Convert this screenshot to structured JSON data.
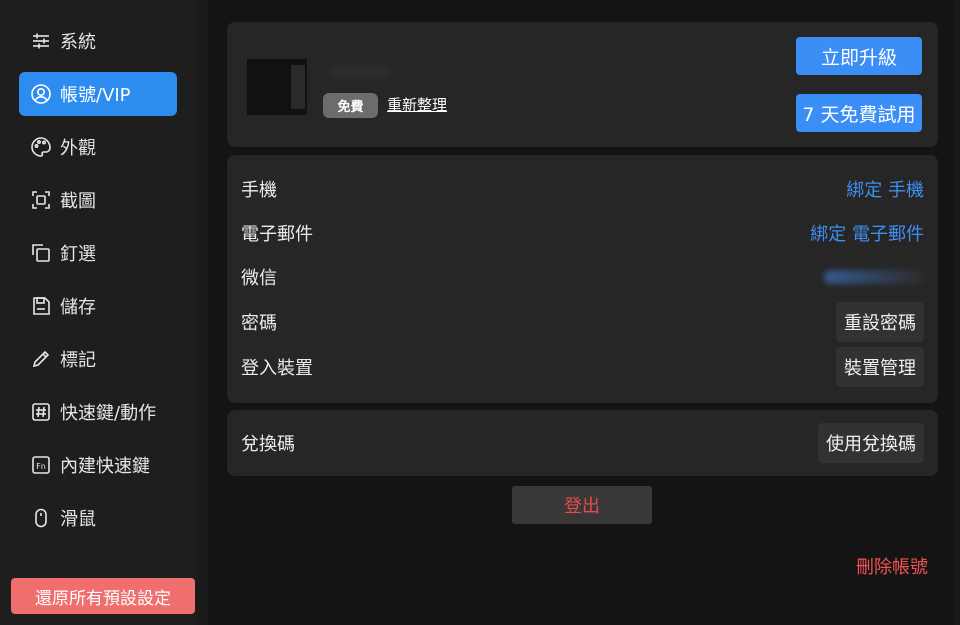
{
  "sidebar": {
    "items": [
      {
        "label": "系統",
        "icon": "sliders-icon",
        "active": false
      },
      {
        "label": "帳號/VIP",
        "icon": "user-circle-icon",
        "active": true
      },
      {
        "label": "外觀",
        "icon": "palette-icon",
        "active": false
      },
      {
        "label": "截圖",
        "icon": "screenshot-icon",
        "active": false
      },
      {
        "label": "釘選",
        "icon": "pin-copy-icon",
        "active": false
      },
      {
        "label": "儲存",
        "icon": "save-icon",
        "active": false
      },
      {
        "label": "標記",
        "icon": "pencil-icon",
        "active": false
      },
      {
        "label": "快速鍵/動作",
        "icon": "hash-key-icon",
        "active": false
      },
      {
        "label": "內建快速鍵",
        "icon": "fn-key-icon",
        "active": false
      },
      {
        "label": "滑鼠",
        "icon": "mouse-icon",
        "active": false
      }
    ],
    "reset_label": "還原所有預設設定"
  },
  "profile": {
    "badge": "免費",
    "refresh_label": "重新整理",
    "upgrade_label": "立即升級",
    "trial_label": "7 天免費試用"
  },
  "account": {
    "phone": {
      "label": "手機",
      "action": "綁定 手機"
    },
    "email": {
      "label": "電子郵件",
      "action": "綁定 電子郵件"
    },
    "wechat": {
      "label": "微信"
    },
    "password": {
      "label": "密碼",
      "action": "重設密碼"
    },
    "devices": {
      "label": "登入裝置",
      "action": "裝置管理"
    }
  },
  "redeem": {
    "label": "兌換碼",
    "action": "使用兌換碼"
  },
  "logout_label": "登出",
  "delete_label": "刪除帳號",
  "colors": {
    "accent": "#2d8cf0",
    "danger": "#e84a4a",
    "reset": "#f06e6e"
  }
}
